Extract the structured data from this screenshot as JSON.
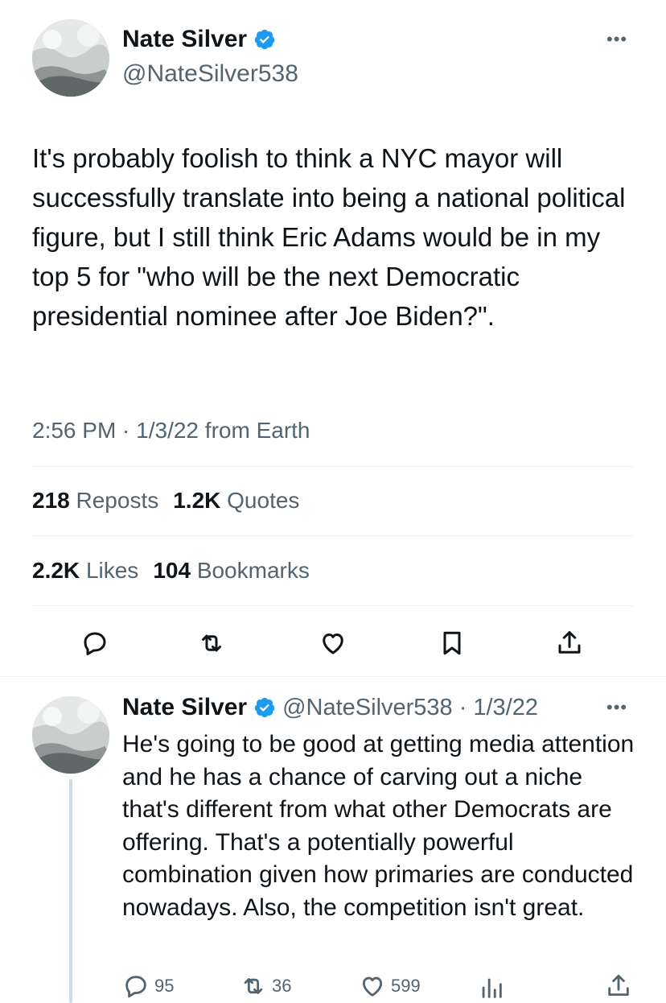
{
  "tweet": {
    "author_name": "Nate Silver",
    "author_handle": "@NateSilver538",
    "more_icon": "ellipsis-icon",
    "text": "It's probably foolish to think a NYC mayor will successfully translate into being a national political figure, but I still think Eric Adams would be in my top 5 for \"who will be the next Democratic presidential nominee after Joe Biden?\".",
    "timestamp": "2:56 PM · 1/3/22 from Earth",
    "stats": {
      "reposts_count": "218",
      "reposts_label": "Reposts",
      "quotes_count": "1.2K",
      "quotes_label": "Quotes",
      "likes_count": "2.2K",
      "likes_label": "Likes",
      "bookmarks_count": "104",
      "bookmarks_label": "Bookmarks"
    },
    "actions": [
      "reply-icon",
      "repost-icon",
      "like-icon",
      "bookmark-icon",
      "share-icon"
    ]
  },
  "reply": {
    "author_name": "Nate Silver",
    "author_handle": "@NateSilver538",
    "separator": "·",
    "date": "1/3/22",
    "text": "He's going to be good at getting media attention and he has a chance of carving out a niche that's different from what other Democrats are offering. That's a potentially powerful combination given how primaries are conducted nowadays. Also, the competition isn't great.",
    "replies": "95",
    "reposts": "36",
    "likes": "599"
  },
  "colors": {
    "verified": "#1d9bf0",
    "secondary_text": "#536471",
    "divider": "#eff3f4"
  }
}
